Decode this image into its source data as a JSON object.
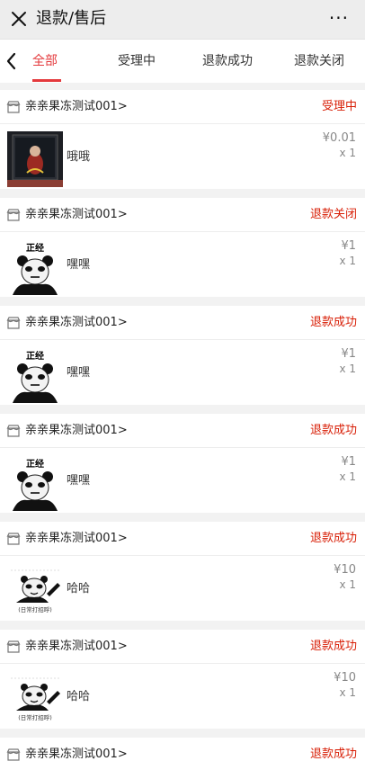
{
  "header": {
    "title": "退款/售后",
    "close_icon": "close-icon",
    "more_label": "···"
  },
  "tabs": [
    {
      "label": "全部",
      "active": true
    },
    {
      "label": "受理中",
      "active": false
    },
    {
      "label": "退款成功",
      "active": false
    },
    {
      "label": "退款关闭",
      "active": false
    }
  ],
  "accent_color": "#e4393c",
  "orders": [
    {
      "shop": "亲亲果冻测试001>",
      "status": "受理中",
      "item": "哦哦",
      "price": "¥0.01",
      "qty": "x 1",
      "thumb": "display-box-image"
    },
    {
      "shop": "亲亲果冻测试001>",
      "status": "退款关闭",
      "item": "嘿嘿",
      "price": "¥1",
      "qty": "x 1",
      "thumb": "panda-meme-image",
      "thumb_caption": "正经"
    },
    {
      "shop": "亲亲果冻测试001>",
      "status": "退款成功",
      "item": "嘿嘿",
      "price": "¥1",
      "qty": "x 1",
      "thumb": "panda-meme-image",
      "thumb_caption": "正经"
    },
    {
      "shop": "亲亲果冻测试001>",
      "status": "退款成功",
      "item": "嘿嘿",
      "price": "¥1",
      "qty": "x 1",
      "thumb": "panda-meme-image",
      "thumb_caption": "正经"
    },
    {
      "shop": "亲亲果冻测试001>",
      "status": "退款成功",
      "item": "哈哈",
      "price": "¥10",
      "qty": "x 1",
      "thumb": "panda-wave-image",
      "thumb_caption": "(日常打招呼)"
    },
    {
      "shop": "亲亲果冻测试001>",
      "status": "退款成功",
      "item": "哈哈",
      "price": "¥10",
      "qty": "x 1",
      "thumb": "panda-wave-image",
      "thumb_caption": "(日常打招呼)"
    },
    {
      "shop": "亲亲果冻测试001>",
      "status": "退款成功"
    }
  ]
}
